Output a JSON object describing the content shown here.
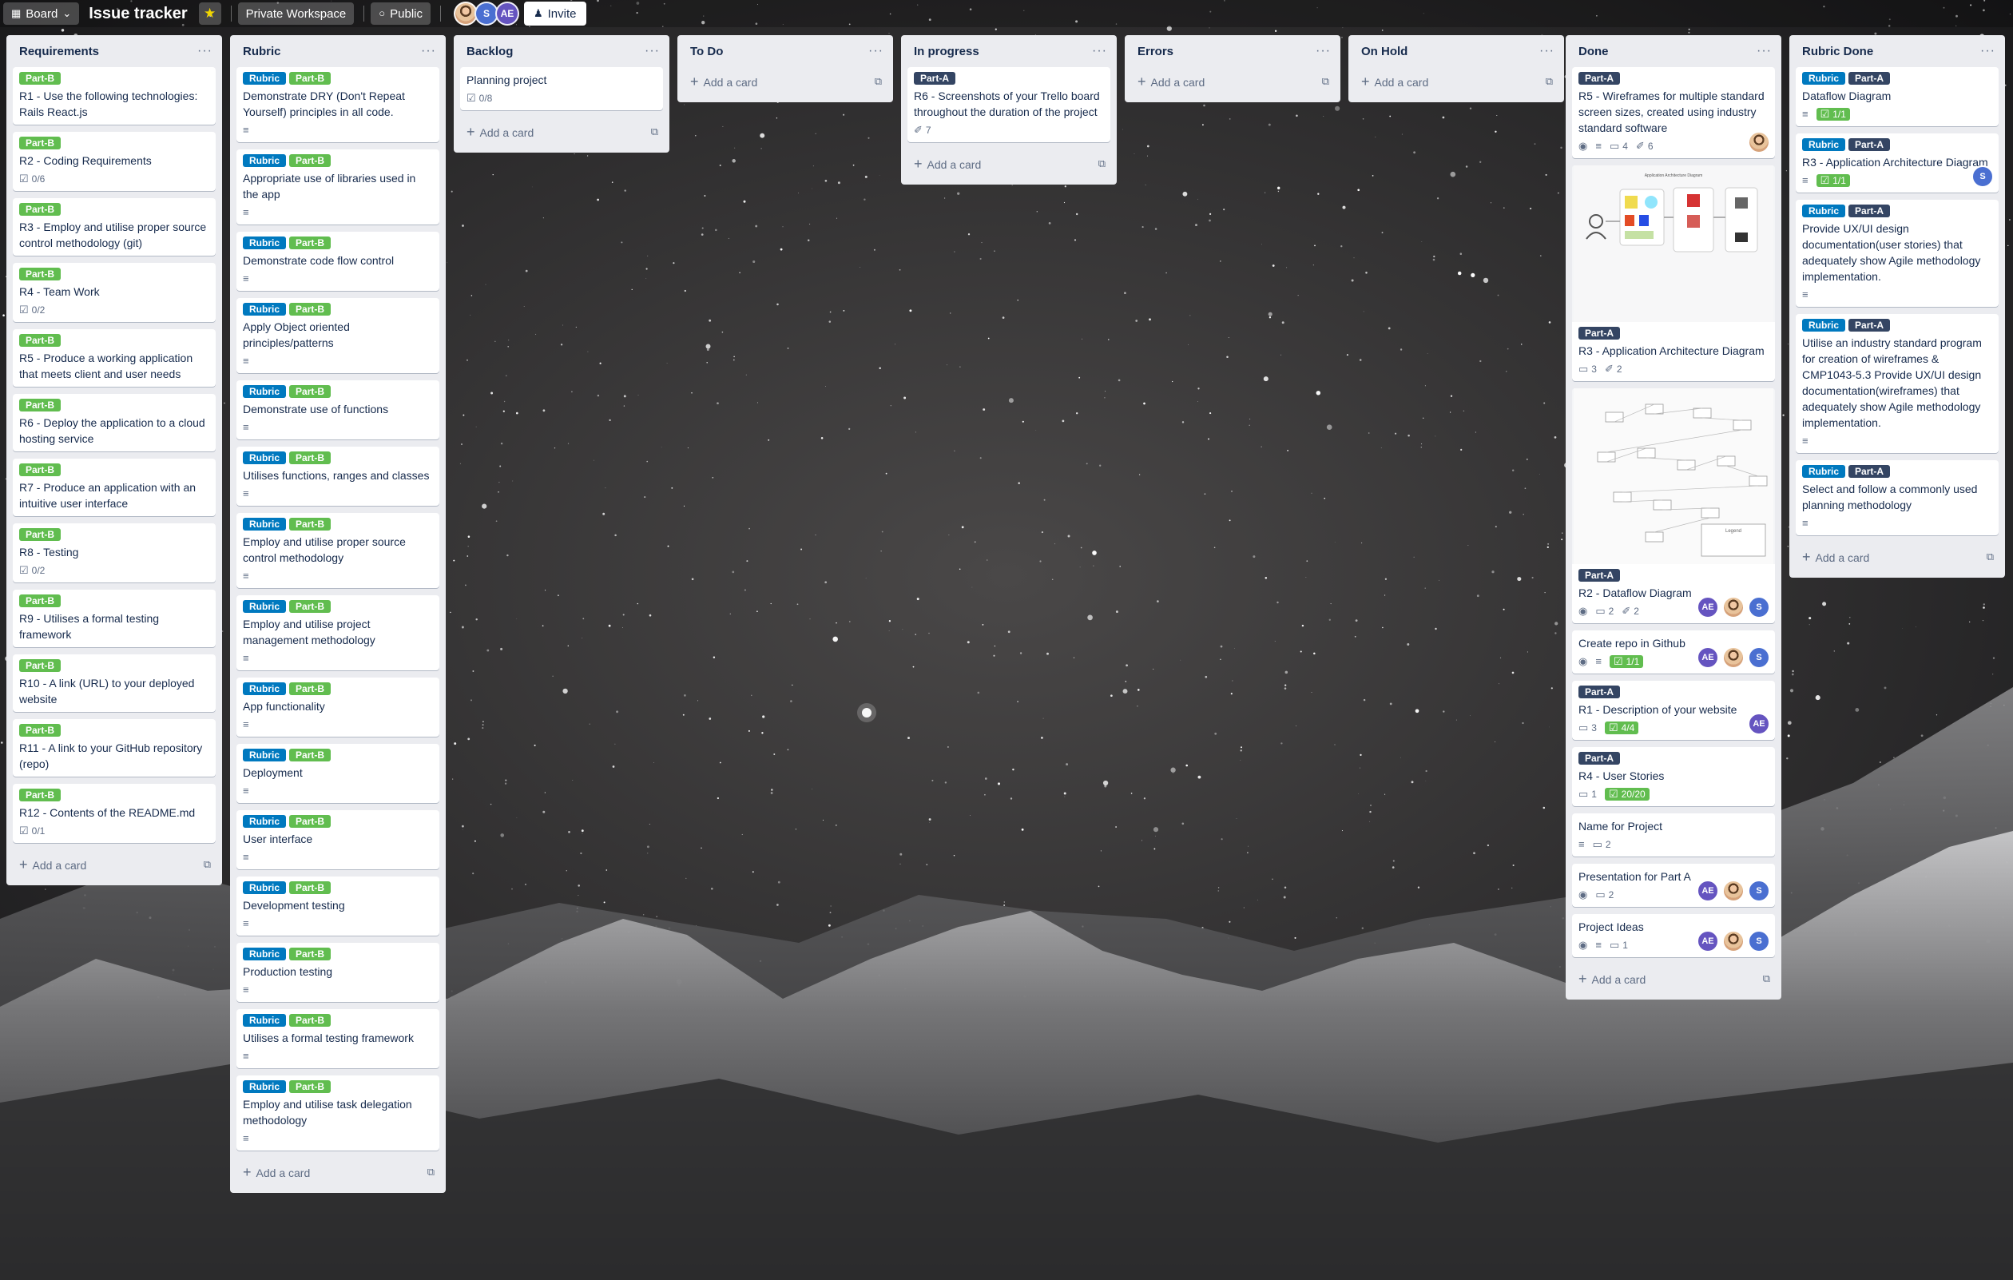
{
  "topbar": {
    "board_switch": "Board",
    "title": "Issue tracker",
    "workspace": "Private Workspace",
    "visibility": "Public",
    "member_initials": [
      "S",
      "AE"
    ],
    "invite": "Invite"
  },
  "add_card_label": "Add a card",
  "lists": [
    {
      "title": "Requirements"
    },
    {
      "title": "Rubric"
    },
    {
      "title": "Backlog"
    },
    {
      "title": "To Do"
    },
    {
      "title": "In progress"
    },
    {
      "title": "Errors"
    },
    {
      "title": "On Hold"
    },
    {
      "title": "Done"
    },
    {
      "title": "Rubric Done"
    }
  ],
  "labels": {
    "part_b": "Part-B",
    "part_a": "Part-A",
    "rubric": "Rubric"
  },
  "requirements": [
    {
      "title": "R1 - Use the following technologies: Rails React.js"
    },
    {
      "title": "R2 - Coding Requirements",
      "checklist": "0/6"
    },
    {
      "title": "R3 - Employ and utilise proper source control methodology (git)"
    },
    {
      "title": "R4 - Team Work",
      "checklist": "0/2"
    },
    {
      "title": "R5 - Produce a working application that meets client and user needs"
    },
    {
      "title": "R6 - Deploy the application to a cloud hosting service"
    },
    {
      "title": "R7 - Produce an application with an intuitive user interface"
    },
    {
      "title": "R8 - Testing",
      "checklist": "0/2"
    },
    {
      "title": "R9 - Utilises a formal testing framework"
    },
    {
      "title": "R10 - A link (URL) to your deployed website"
    },
    {
      "title": "R11 - A link to your GitHub repository (repo)"
    },
    {
      "title": "R12 - Contents of the README.md",
      "checklist": "0/1"
    }
  ],
  "rubric": [
    {
      "title": "Demonstrate DRY (Don't Repeat Yourself) principles in all code."
    },
    {
      "title": "Appropriate use of libraries used in the app"
    },
    {
      "title": "Demonstrate code flow control"
    },
    {
      "title": "Apply Object oriented principles/patterns"
    },
    {
      "title": "Demonstrate use of functions"
    },
    {
      "title": "Utilises functions, ranges and classes"
    },
    {
      "title": "Employ and utilise proper source control methodology"
    },
    {
      "title": "Employ and utilise project management methodology"
    },
    {
      "title": "App functionality"
    },
    {
      "title": "Deployment"
    },
    {
      "title": "User interface"
    },
    {
      "title": "Development testing"
    },
    {
      "title": "Production testing"
    },
    {
      "title": "Utilises a formal testing framework"
    },
    {
      "title": "Employ and utilise task delegation methodology"
    }
  ],
  "backlog": [
    {
      "title": "Planning project",
      "checklist": "0/8"
    }
  ],
  "in_progress": [
    {
      "title": "R6 - Screenshots of your Trello board throughout the duration of the project",
      "attachments": "7"
    }
  ],
  "done": [
    {
      "title": "R5 - Wireframes for multiple standard screen sizes, created using industry standard software",
      "comments": "4",
      "attachments": "6"
    },
    {
      "title": "R3 - Application Architecture Diagram",
      "comments": "3",
      "attachments": "2",
      "cover_caption": "Application Architecture Diagram"
    },
    {
      "title": "R2 - Dataflow Diagram",
      "comments": "2",
      "attachments": "2",
      "cover_caption": "Legend"
    },
    {
      "title": "Create repo in Github",
      "checklist": "1/1"
    },
    {
      "title": "R1 - Description of your website",
      "comments": "3",
      "checklist": "4/4"
    },
    {
      "title": "R4 - User Stories",
      "comments": "1",
      "checklist": "20/20"
    },
    {
      "title": "Name for Project",
      "comments": "2"
    },
    {
      "title": "Presentation for Part A",
      "comments": "2"
    },
    {
      "title": "Project Ideas",
      "comments": "1"
    }
  ],
  "rubric_done": [
    {
      "title": "Dataflow Diagram",
      "checklist": "1/1"
    },
    {
      "title": "R3 - Application Architecture Diagram",
      "checklist": "1/1"
    },
    {
      "title": "Provide UX/UI design documentation(user stories) that adequately show Agile methodology implementation."
    },
    {
      "title": "Utilise an industry standard program for creation of wireframes & CMP1043-5.3 Provide UX/UI design documentation(wireframes) that adequately show Agile methodology implementation."
    },
    {
      "title": "Select and follow a commonly used planning methodology"
    }
  ],
  "member_initials": {
    "ae": "AE",
    "s": "S"
  },
  "icons": {
    "board": "board-icon",
    "star": "star-icon",
    "globe": "globe-icon",
    "invite": "person-add-icon",
    "menu": "ellipsis-icon",
    "plus": "plus-icon",
    "template": "card-template-icon",
    "checklist": "checklist-icon",
    "description": "description-icon",
    "comment": "comment-icon",
    "attachment": "paperclip-icon",
    "watch": "eye-icon"
  },
  "colors": {
    "part_b": "#61bd4f",
    "rubric": "#0079bf",
    "part_a": "#344563",
    "list_bg": "#ebecf0"
  }
}
